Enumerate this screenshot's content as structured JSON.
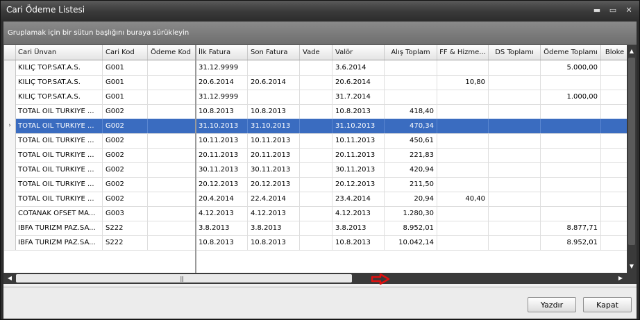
{
  "window": {
    "title": "Cari Ödeme Listesi",
    "minimize": "▬",
    "maximize": "▭",
    "close": "✕"
  },
  "group_panel": {
    "text": "Gruplamak için bir sütun başlığını buraya sürükleyin"
  },
  "columns": [
    "Cari Ünvan",
    "Cari Kod",
    "Ödeme Kod",
    "İlk Fatura",
    "Son Fatura",
    "Vade",
    "Valör",
    "Alış Toplam",
    "FF & Hizme...",
    "DS Toplamı",
    "Ödeme Toplamı",
    "Bloke"
  ],
  "rows": [
    [
      "KILIÇ TOP.SAT.A.S.",
      "G001",
      "",
      "31.12.9999",
      "",
      "",
      "3.6.2014",
      "",
      "",
      "",
      "5.000,00",
      ""
    ],
    [
      "KILIÇ TOP.SAT.A.S.",
      "G001",
      "",
      "20.6.2014",
      "20.6.2014",
      "",
      "20.6.2014",
      "",
      "10,80",
      "",
      "",
      ""
    ],
    [
      "KILIÇ TOP.SAT.A.S.",
      "G001",
      "",
      "31.12.9999",
      "",
      "",
      "31.7.2014",
      "",
      "",
      "",
      "1.000,00",
      ""
    ],
    [
      "TOTAL OIL TURKIYE ...",
      "G002",
      "",
      "10.8.2013",
      "10.8.2013",
      "",
      "10.8.2013",
      "418,40",
      "",
      "",
      "",
      ""
    ],
    [
      "TOTAL OIL TURKIYE ...",
      "G002",
      "",
      "31.10.2013",
      "31.10.2013",
      "",
      "31.10.2013",
      "470,34",
      "",
      "",
      "",
      ""
    ],
    [
      "TOTAL OIL TURKIYE ...",
      "G002",
      "",
      "10.11.2013",
      "10.11.2013",
      "",
      "10.11.2013",
      "450,61",
      "",
      "",
      "",
      ""
    ],
    [
      "TOTAL OIL TURKIYE ...",
      "G002",
      "",
      "20.11.2013",
      "20.11.2013",
      "",
      "20.11.2013",
      "221,83",
      "",
      "",
      "",
      ""
    ],
    [
      "TOTAL OIL TURKIYE ...",
      "G002",
      "",
      "30.11.2013",
      "30.11.2013",
      "",
      "30.11.2013",
      "420,94",
      "",
      "",
      "",
      ""
    ],
    [
      "TOTAL OIL TURKIYE ...",
      "G002",
      "",
      "20.12.2013",
      "20.12.2013",
      "",
      "20.12.2013",
      "211,50",
      "",
      "",
      "",
      ""
    ],
    [
      "TOTAL OIL TURKIYE ...",
      "G002",
      "",
      "20.4.2014",
      "22.4.2014",
      "",
      "23.4.2014",
      "20,94",
      "40,40",
      "",
      "",
      ""
    ],
    [
      "COTANAK OFSET MA...",
      "G003",
      "",
      "4.12.2013",
      "4.12.2013",
      "",
      "4.12.2013",
      "1.280,30",
      "",
      "",
      "",
      ""
    ],
    [
      "IBFA TURIZM PAZ.SA...",
      "S222",
      "",
      "3.8.2013",
      "3.8.2013",
      "",
      "3.8.2013",
      "8.952,01",
      "",
      "",
      "8.877,71",
      ""
    ],
    [
      "IBFA TURIZM PAZ.SA...",
      "S222",
      "",
      "10.8.2013",
      "10.8.2013",
      "",
      "10.8.2013",
      "10.042,14",
      "",
      "",
      "8.952,01",
      ""
    ]
  ],
  "selected_row": 4,
  "row_indicator": "›",
  "grip": "|||",
  "footer": {
    "print": "Yazdır",
    "close": "Kapat"
  },
  "colors": {
    "selection": "#3a6cc0",
    "marker": "#e01010"
  }
}
